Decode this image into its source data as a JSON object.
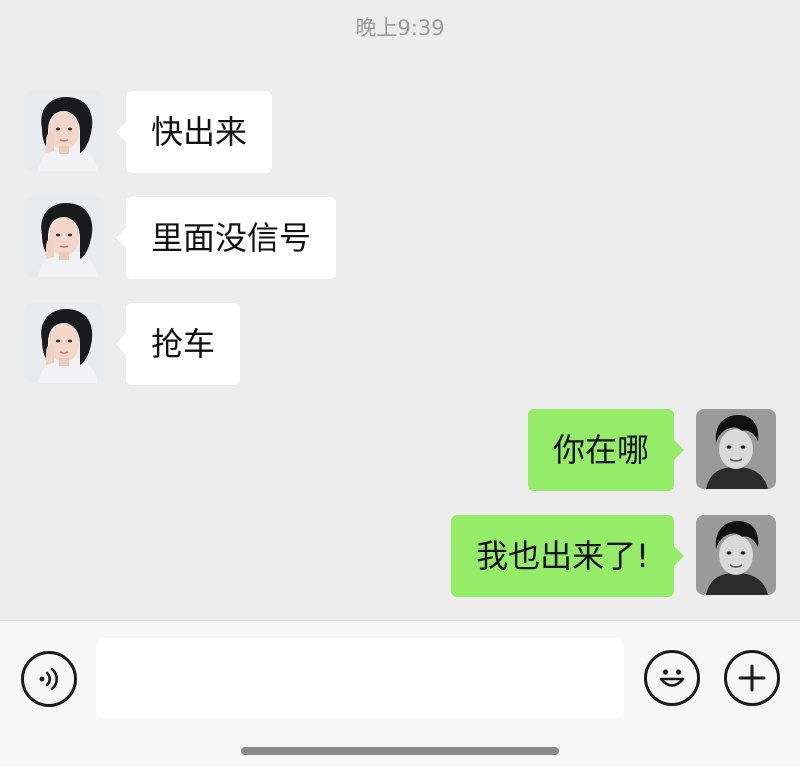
{
  "timestamp": "晚上9:39",
  "messages": [
    {
      "side": "left",
      "sender": "contact",
      "text": "快出来"
    },
    {
      "side": "left",
      "sender": "contact",
      "text": "里面没信号"
    },
    {
      "side": "left",
      "sender": "contact",
      "text": "抢车"
    },
    {
      "side": "right",
      "sender": "me",
      "text": "你在哪"
    },
    {
      "side": "right",
      "sender": "me",
      "text": "我也出来了!"
    }
  ],
  "input_bar": {
    "voice_icon": "voice-icon",
    "emoji_icon": "emoji-icon",
    "plus_icon": "plus-icon",
    "text_value": "",
    "placeholder": ""
  },
  "colors": {
    "background": "#ededed",
    "incoming_bubble": "#ffffff",
    "outgoing_bubble": "#95ec69",
    "timestamp_text": "#9a9a9a"
  }
}
